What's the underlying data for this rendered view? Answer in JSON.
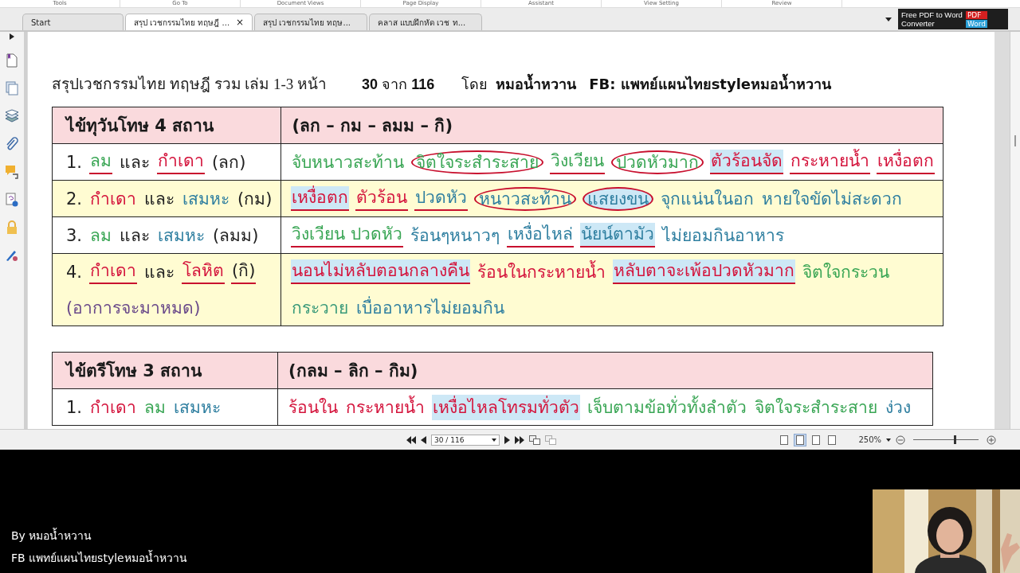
{
  "ribbon": [
    "Tools",
    "Go To",
    "Document Views",
    "Page Display",
    "Assistant",
    "View Setting",
    "Review"
  ],
  "tabs": [
    {
      "label": "Start",
      "selected": false
    },
    {
      "label": "สรุป เวชกรรมไทย ทฤษฎี ...",
      "selected": true,
      "close": "×"
    },
    {
      "label": "สรุป เวชกรรมไทย ทฤษ...",
      "selected": false
    },
    {
      "label": "คลาส แบบฝึกหัด เวช ท...",
      "selected": false
    }
  ],
  "ad": {
    "line1": "Free PDF to Word",
    "line2": "Converter",
    "badge1": "PDF",
    "badge2": "Word"
  },
  "page": {
    "title": "สรุปเวชกรรมไทย ทฤษฎี รวม เล่ม 1-3 หน้า",
    "page_info": "**30** จาก **116**",
    "by": "โดย",
    "author": "หมอน้ำหวาน",
    "fb": "FB: แพทย์แผนไทยstyleหมอน้ำหวาน",
    "tables": [
      {
        "rows": [
          {
            "kind": "header",
            "color": "#fadadd",
            "cells": [
              {
                "lines": [
                  [
                    {
                      "text": "ไข้ทุวันโทษ 4 สถาน",
                      "color": "#1a1a1a"
                    }
                  ]
                ]
              },
              {
                "lines": [
                  [
                    {
                      "text": "(ลก – กม – ลมม – กิ)",
                      "color": "#1a1a1a"
                    }
                  ]
                ]
              }
            ]
          },
          {
            "kind": "row",
            "color": "#ffffff",
            "cells": [
              {
                "lines": [
                  [
                    {
                      "text": "1.",
                      "color": "#222222"
                    },
                    {
                      "text": "ลม",
                      "color": "#3aa655",
                      "underlined": true
                    },
                    {
                      "text": "และ",
                      "color": "#222222"
                    },
                    {
                      "text": "กำเดา",
                      "color": "#d4143c",
                      "underlined": true
                    },
                    {
                      "text": "(ลก)",
                      "color": "#222222"
                    }
                  ]
                ]
              },
              {
                "lines": [
                  [
                    {
                      "text": "จับหนาวสะท้าน",
                      "color": "#3aa655"
                    },
                    {
                      "text": "จิตใจระสำระสาย",
                      "color": "#3aa655",
                      "circled": true
                    },
                    {
                      "text": "วิงเวียน",
                      "color": "#3aa655",
                      "underlined": true
                    },
                    {
                      "text": "ปวดหัวมาก",
                      "color": "#3aa655",
                      "circled": true
                    },
                    {
                      "text": "ตัวร้อนจัด",
                      "color": "#d4143c",
                      "highlight": true,
                      "underlined": true
                    },
                    {
                      "text": "กระหายน้ำ",
                      "color": "#d4143c",
                      "underlined": true
                    },
                    {
                      "text": "เหงื่อตก",
                      "color": "#d4143c",
                      "underlined": true
                    }
                  ]
                ]
              }
            ]
          },
          {
            "kind": "row",
            "color": "#fffcd2",
            "cells": [
              {
                "lines": [
                  [
                    {
                      "text": "2.",
                      "color": "#222222"
                    },
                    {
                      "text": "กำเดา",
                      "color": "#d4143c"
                    },
                    {
                      "text": "และ",
                      "color": "#222222"
                    },
                    {
                      "text": "เสมหะ",
                      "color": "#2f7fa0"
                    },
                    {
                      "text": "(กม)",
                      "color": "#222222"
                    }
                  ]
                ]
              },
              {
                "lines": [
                  [
                    {
                      "text": "เหงื่อตก",
                      "color": "#d4143c",
                      "highlight": true,
                      "underlined": true
                    },
                    {
                      "text": "ตัวร้อน",
                      "color": "#d4143c",
                      "underlined": true
                    },
                    {
                      "text": "ปวดหัว",
                      "color": "#2f7fa0",
                      "underlined": true
                    },
                    {
                      "text": "หนาวสะท้าน",
                      "color": "#2f7fa0",
                      "circled": true
                    },
                    {
                      "text": "แสยงขน",
                      "color": "#2f7fa0",
                      "highlight": true,
                      "circled": true
                    },
                    {
                      "text": "จุกแน่นในอก",
                      "color": "#2f7fa0"
                    },
                    {
                      "text": "หายใจขัดไม่สะดวก",
                      "color": "#2f7fa0"
                    }
                  ]
                ]
              }
            ]
          },
          {
            "kind": "row",
            "color": "#ffffff",
            "cells": [
              {
                "lines": [
                  [
                    {
                      "text": "3.",
                      "color": "#222222"
                    },
                    {
                      "text": "ลม",
                      "color": "#3aa655"
                    },
                    {
                      "text": "และ",
                      "color": "#222222"
                    },
                    {
                      "text": "เสมหะ",
                      "color": "#2f7fa0"
                    },
                    {
                      "text": "(ลมม)",
                      "color": "#222222"
                    }
                  ]
                ]
              },
              {
                "lines": [
                  [
                    {
                      "text": "วิงเวียน ปวดหัว",
                      "color": "#3aa655",
                      "underlined": true
                    },
                    {
                      "text": "ร้อนๆหนาวๆ",
                      "color": "#2f7fa0"
                    },
                    {
                      "text": "เหงื่อไหล่",
                      "color": "#2f7fa0",
                      "underlined": true
                    },
                    {
                      "text": "นัยน์ตามัว",
                      "color": "#2f7fa0",
                      "highlight": true,
                      "underlined": true
                    },
                    {
                      "text": "ไม่ยอมกินอาหาร",
                      "color": "#2f7fa0"
                    }
                  ]
                ]
              }
            ]
          },
          {
            "kind": "row",
            "color": "#fffcd2",
            "cells": [
              {
                "lines": [
                  [
                    {
                      "text": "4.",
                      "color": "#222222"
                    },
                    {
                      "text": "กำเดา",
                      "color": "#d4143c",
                      "underlined": true
                    },
                    {
                      "text": "และ",
                      "color": "#222222"
                    },
                    {
                      "text": "โลหิต",
                      "color": "#d4143c",
                      "underlined": true
                    },
                    {
                      "text": "(กิ)",
                      "color": "#222222",
                      "underlined": true
                    }
                  ],
                  [
                    {
                      "text": "(อาการจะมาหมด)",
                      "color": "#6a4a8a"
                    }
                  ]
                ]
              },
              {
                "lines": [
                  [
                    {
                      "text": "นอนไม่หลับตอนกลางคืน",
                      "color": "#d4143c",
                      "highlight": true,
                      "underlined": true
                    },
                    {
                      "text": "ร้อนในกระหายน้ำ",
                      "color": "#d4143c"
                    },
                    {
                      "text": "หลับตาจะเพ้อปวดหัวมาก",
                      "color": "#d4143c",
                      "highlight": true,
                      "underlined": true
                    },
                    {
                      "text": "จิตใจกระวน",
                      "color": "#3aa655"
                    }
                  ],
                  [
                    {
                      "text": "กระวาย",
                      "color": "#3a9a7a"
                    },
                    {
                      "text": "เบื่ออาหารไม่ยอมกิน",
                      "color": "#2f7fa0"
                    }
                  ]
                ]
              }
            ]
          }
        ]
      },
      {
        "rows": [
          {
            "kind": "header",
            "color": "#fadadd",
            "cells": [
              {
                "lines": [
                  [
                    {
                      "text": "ไข้ตรีโทษ 3 สถาน",
                      "color": "#1a1a1a"
                    }
                  ]
                ]
              },
              {
                "lines": [
                  [
                    {
                      "text": "(กลม – ลิก – กิม)",
                      "color": "#1a1a1a"
                    }
                  ]
                ]
              }
            ]
          },
          {
            "kind": "row",
            "color": "#ffffff",
            "cells": [
              {
                "lines": [
                  [
                    {
                      "text": "1.",
                      "color": "#222222"
                    },
                    {
                      "text": "กำเดา",
                      "color": "#d4143c"
                    },
                    {
                      "text": "ลม",
                      "color": "#3aa655"
                    },
                    {
                      "text": "เสมหะ",
                      "color": "#2f7fa0"
                    }
                  ]
                ]
              },
              {
                "lines": [
                  [
                    {
                      "text": "ร้อนใน",
                      "color": "#d4143c"
                    },
                    {
                      "text": "กระหายน้ำ",
                      "color": "#d4143c"
                    },
                    {
                      "text": "เหงื่อไหลโทรมทั่วตัว",
                      "color": "#d4143c",
                      "highlight": true
                    },
                    {
                      "text": "เจ็บตามข้อทั่วทั้งลำตัว",
                      "color": "#3aa655"
                    },
                    {
                      "text": "จิตใจระสำระสาย",
                      "color": "#3aa655"
                    },
                    {
                      "text": "ง่วง",
                      "color": "#2f7fa0"
                    }
                  ]
                ]
              }
            ]
          }
        ]
      }
    ]
  },
  "status_bar": {
    "page_field": "30 / 116",
    "view_modes": [
      {
        "selected": false
      },
      {
        "selected": true
      },
      {
        "selected": false
      },
      {
        "selected": false
      }
    ],
    "zoom": "250%",
    "zoom_slider": {
      "level": 0.62
    }
  },
  "captions": [
    "By หมอน้ำหวาน",
    "FB แพทย์แผนไทยstyleหมอน้ำหวาน"
  ]
}
